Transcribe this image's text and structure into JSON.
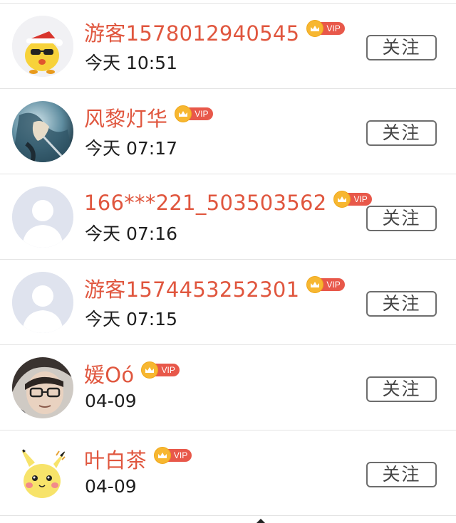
{
  "follow_label": "关注",
  "vip_label": "VIP",
  "colors": {
    "name": "#e0563e",
    "vip_badge": "#e8584a",
    "crown": "#f7b731",
    "divider": "#e4e4e4"
  },
  "users": [
    {
      "name": "游客1578012940545",
      "time": "今天 10:51",
      "avatar": "yellow-bird-santa-hat-icon"
    },
    {
      "name": "风黎灯华",
      "time": "今天 07:17",
      "avatar": "fantasy-character-icon"
    },
    {
      "name": "166***221_503503562",
      "time": "今天 07:16",
      "avatar": "default-user-icon"
    },
    {
      "name": "游客1574453252301",
      "time": "今天 07:15",
      "avatar": "default-user-icon"
    },
    {
      "name": "媛Oó",
      "time": "04-09",
      "avatar": "photo-with-glasses-icon"
    },
    {
      "name": "叶白茶",
      "time": "04-09",
      "avatar": "pikachu-icon"
    }
  ]
}
